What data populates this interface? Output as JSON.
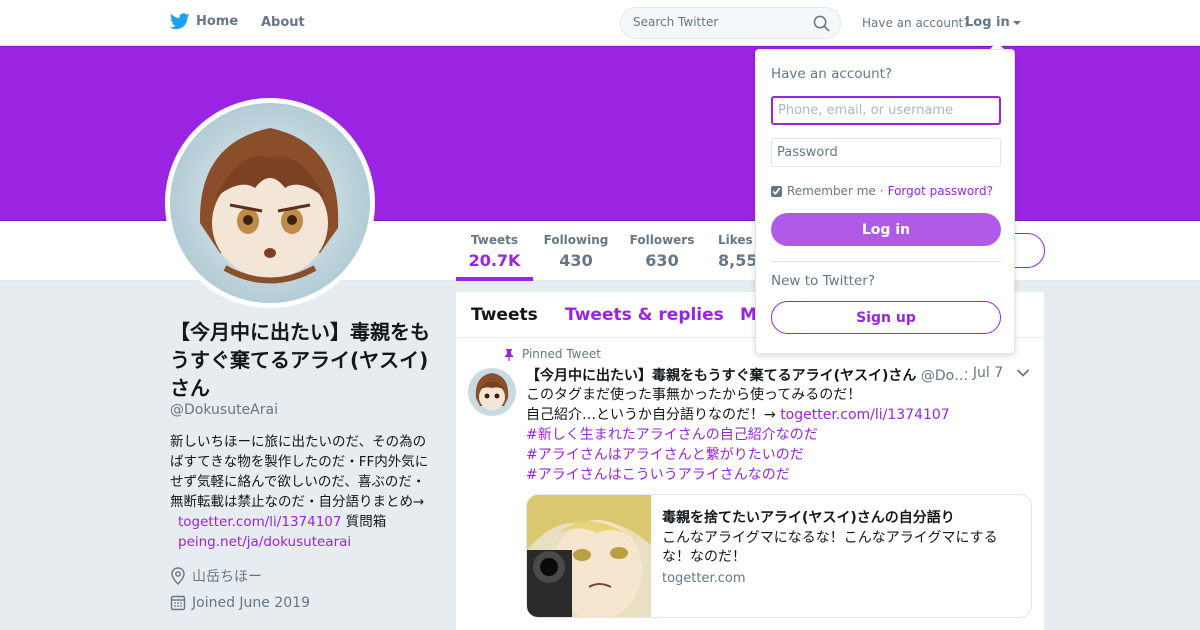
{
  "nav": {
    "home_label": "Home",
    "about_label": "About",
    "search_placeholder": "Search Twitter",
    "have_account": "Have an account?",
    "login_label": "Log in"
  },
  "profile": {
    "name": "【今月中に出たい】毒親をもうすぐ棄てるアライ(ヤスイ)さん",
    "handle": "@DokusuteArai",
    "bio_text": "新しいちほーに旅に出たいのだ、その為のばすてきな物を製作したのだ・FF内外気にせず気軽に絡んで欲しいのだ、喜ぶのだ・無断転載は禁止なのだ・自分語りまとめ→",
    "bio_link1": "togetter.com/li/1374107",
    "bio_mid": "質問箱",
    "bio_link2": "peing.net/ja/dokusutearai",
    "location": "山岳ちほー",
    "joined": "Joined June 2019"
  },
  "stats": [
    {
      "label": "Tweets",
      "value": "20.7K"
    },
    {
      "label": "Following",
      "value": "430"
    },
    {
      "label": "Followers",
      "value": "630"
    },
    {
      "label": "Likes",
      "value": "8,55"
    }
  ],
  "tabs": [
    "Tweets",
    "Tweets & replies",
    "M"
  ],
  "tweet": {
    "pinned_label": "Pinned Tweet",
    "author_name": "【今月中に出たい】毒親をもうすぐ棄てるアライ(ヤスイ)さん",
    "author_handle": "@Do…",
    "date": "· Jul 7",
    "line1": "このタグまだ使った事無かったから使ってみるのだ！",
    "line2": "自己紹介…というか自分語りなのだ！→",
    "link": "togetter.com/li/1374107",
    "hashtags": [
      "#新しく生まれたアライさんの自己紹介なのだ",
      "#アライさんはアライさんと繋がりたいのだ",
      "#アライさんはこういうアライさんなのだ"
    ],
    "card": {
      "title": "毒親を捨てたいアライ(ヤスイ)さんの自分語り",
      "description": "こんなアライグマになるな！こんなアライグマにするな！なのだ！",
      "domain": "togetter.com"
    }
  },
  "login_dropdown": {
    "title": "Have an account?",
    "username_placeholder": "Phone, email, or username",
    "password_placeholder": "Password",
    "remember_label": "Remember me",
    "separator": "·",
    "forgot_label": "Forgot password?",
    "login_button": "Log in",
    "new_label": "New to Twitter?",
    "signup_button": "Sign up"
  },
  "colors": {
    "accent": "#9b24e3",
    "banner": "#9b24e3",
    "background": "#e6ecf0",
    "muted": "#657786"
  }
}
